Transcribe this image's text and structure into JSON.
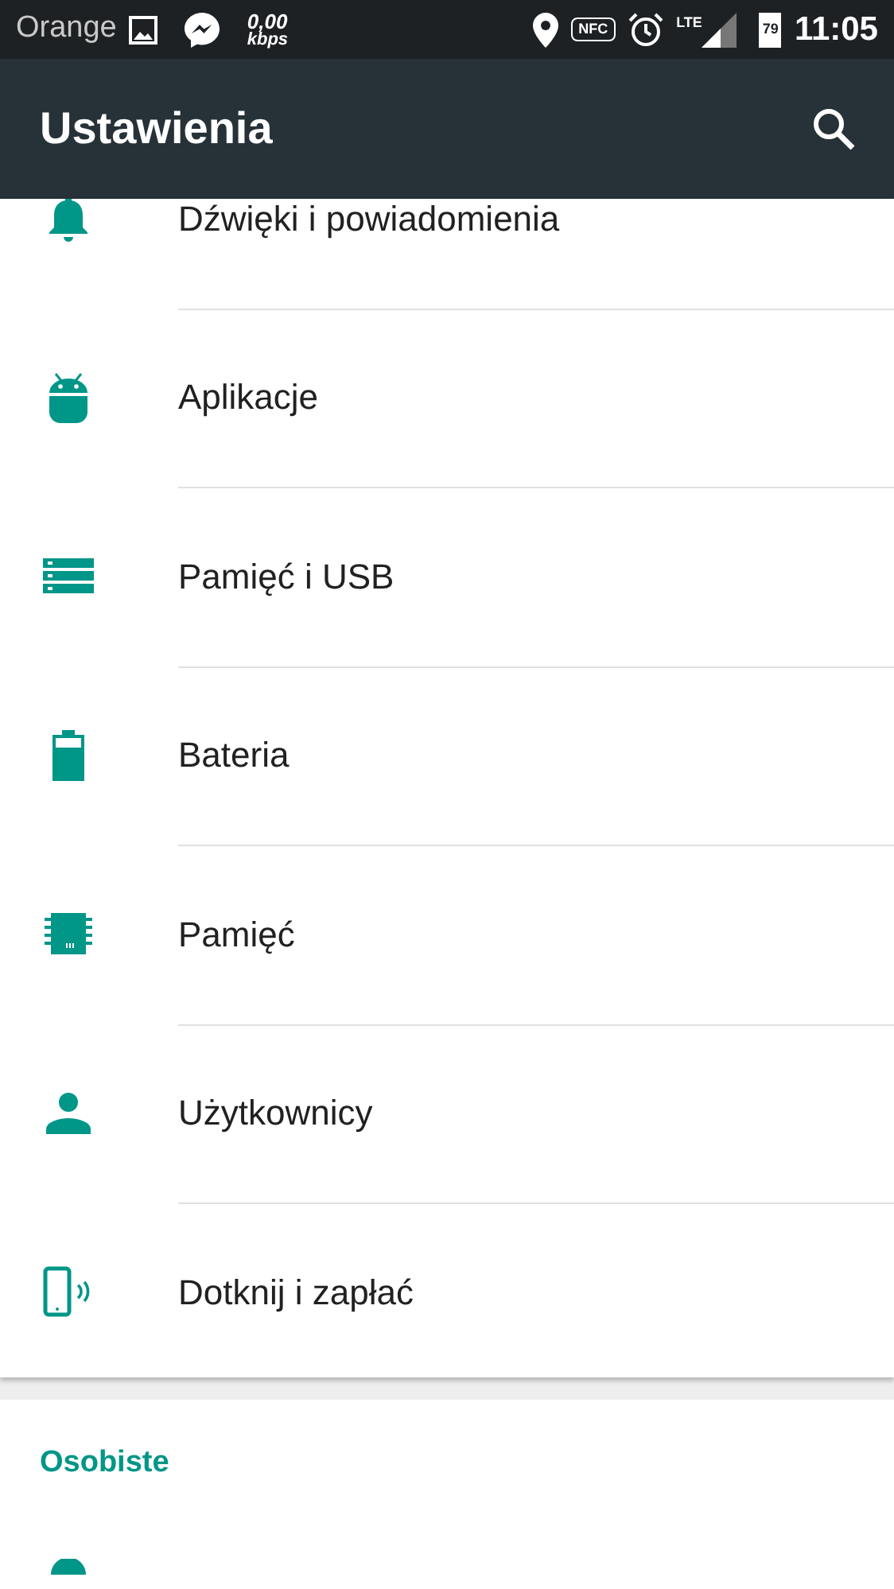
{
  "status_bar": {
    "carrier": "Orange",
    "speed_value": "0,00",
    "speed_unit": "kbps",
    "nfc": "NFC",
    "network": "LTE",
    "battery": "79",
    "time": "11:05"
  },
  "toolbar": {
    "title": "Ustawienia"
  },
  "device_items": [
    {
      "kind": "bell",
      "label": "Dźwięki i powiadomienia"
    },
    {
      "kind": "android",
      "label": "Aplikacje"
    },
    {
      "kind": "storage",
      "label": "Pamięć i USB"
    },
    {
      "kind": "battery",
      "label": "Bateria"
    },
    {
      "kind": "memory",
      "label": "Pamięć"
    },
    {
      "kind": "person",
      "label": "Użytkownicy"
    },
    {
      "kind": "nfc",
      "label": "Dotknij i zapłać"
    }
  ],
  "personal_section": {
    "title": "Osobiste",
    "items": [
      {
        "kind": "location"
      }
    ]
  }
}
